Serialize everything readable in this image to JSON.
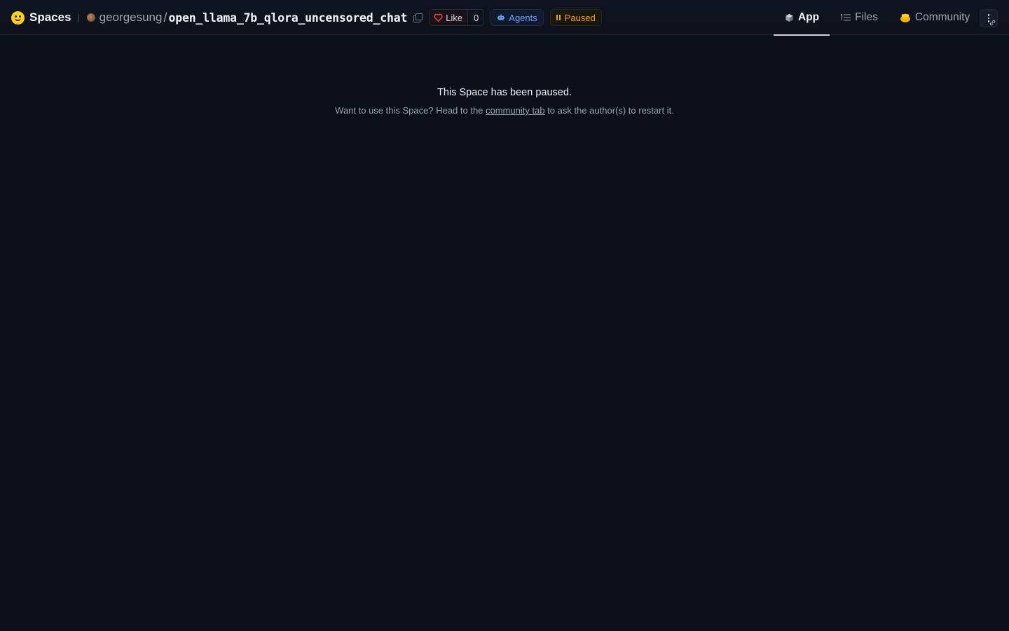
{
  "header": {
    "brand": "Spaces",
    "owner": "georgesung",
    "separator": "/",
    "repo_name": "open_llama_7b_qlora_uncensored_chat",
    "like_label": "Like",
    "like_count": "0",
    "agents_label": "Agents",
    "status_label": "Paused"
  },
  "tabs": [
    {
      "label": "App",
      "icon": "cube-icon",
      "active": true
    },
    {
      "label": "Files",
      "icon": "files-icon",
      "active": false
    },
    {
      "label": "Community",
      "icon": "community-icon",
      "active": false
    }
  ],
  "main": {
    "title": "This Space has been paused.",
    "desc_before": "Want to use this Space? Head to the ",
    "desc_link": "community tab",
    "desc_after": " to ask the author(s) to restart it."
  },
  "colors": {
    "background": "#0b0f19",
    "paused_accent": "#f59e0b",
    "agents_accent": "#60a5fa",
    "like_heart": "#ef4444"
  }
}
